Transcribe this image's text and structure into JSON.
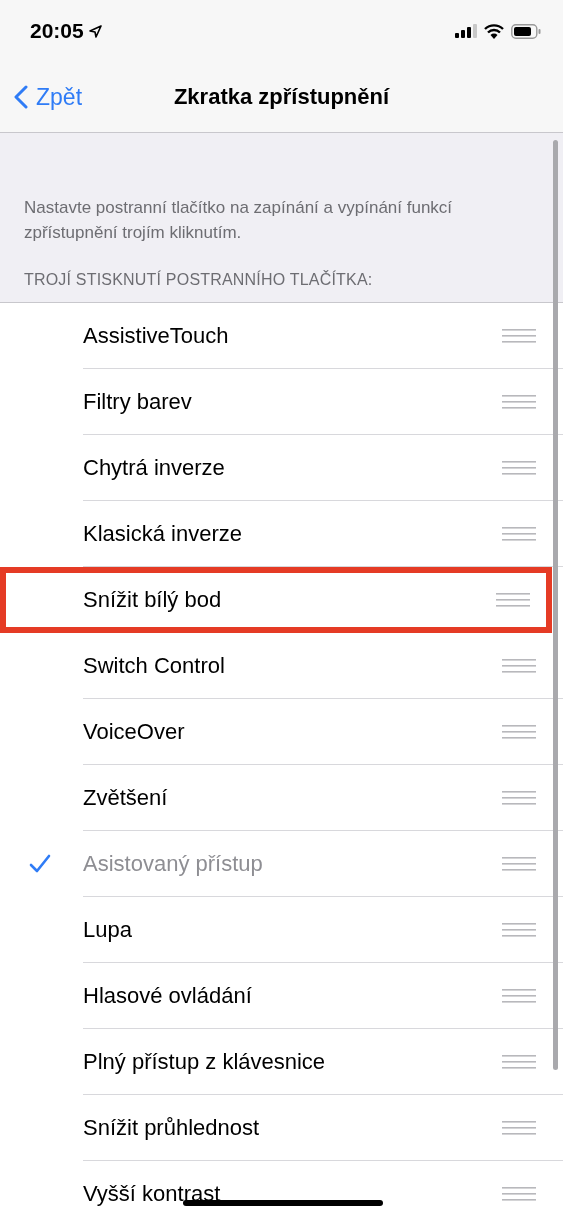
{
  "status_bar": {
    "time": "20:05"
  },
  "nav": {
    "back": "Zpět",
    "title": "Zkratka zpřístupnění"
  },
  "description": "Nastavte postranní tlačítko na zapínání a vypínání funkcí zpřístupnění trojím kliknutím.",
  "section_header": "TROJÍ STISKNUTÍ POSTRANNÍHO TLAČÍTKA:",
  "items": [
    {
      "label": "AssistiveTouch",
      "checked": false,
      "disabled": false,
      "highlighted": false
    },
    {
      "label": "Filtry barev",
      "checked": false,
      "disabled": false,
      "highlighted": false
    },
    {
      "label": "Chytrá inverze",
      "checked": false,
      "disabled": false,
      "highlighted": false
    },
    {
      "label": "Klasická inverze",
      "checked": false,
      "disabled": false,
      "highlighted": false
    },
    {
      "label": "Snížit bílý bod",
      "checked": false,
      "disabled": false,
      "highlighted": true
    },
    {
      "label": "Switch Control",
      "checked": false,
      "disabled": false,
      "highlighted": false
    },
    {
      "label": "VoiceOver",
      "checked": false,
      "disabled": false,
      "highlighted": false
    },
    {
      "label": "Zvětšení",
      "checked": false,
      "disabled": false,
      "highlighted": false
    },
    {
      "label": "Asistovaný přístup",
      "checked": true,
      "disabled": true,
      "highlighted": false
    },
    {
      "label": "Lupa",
      "checked": false,
      "disabled": false,
      "highlighted": false
    },
    {
      "label": "Hlasové ovládání",
      "checked": false,
      "disabled": false,
      "highlighted": false
    },
    {
      "label": "Plný přístup z klávesnice",
      "checked": false,
      "disabled": false,
      "highlighted": false
    },
    {
      "label": "Snížit průhlednost",
      "checked": false,
      "disabled": false,
      "highlighted": false
    },
    {
      "label": "Vyšší kontrast",
      "checked": false,
      "disabled": false,
      "highlighted": false
    }
  ]
}
